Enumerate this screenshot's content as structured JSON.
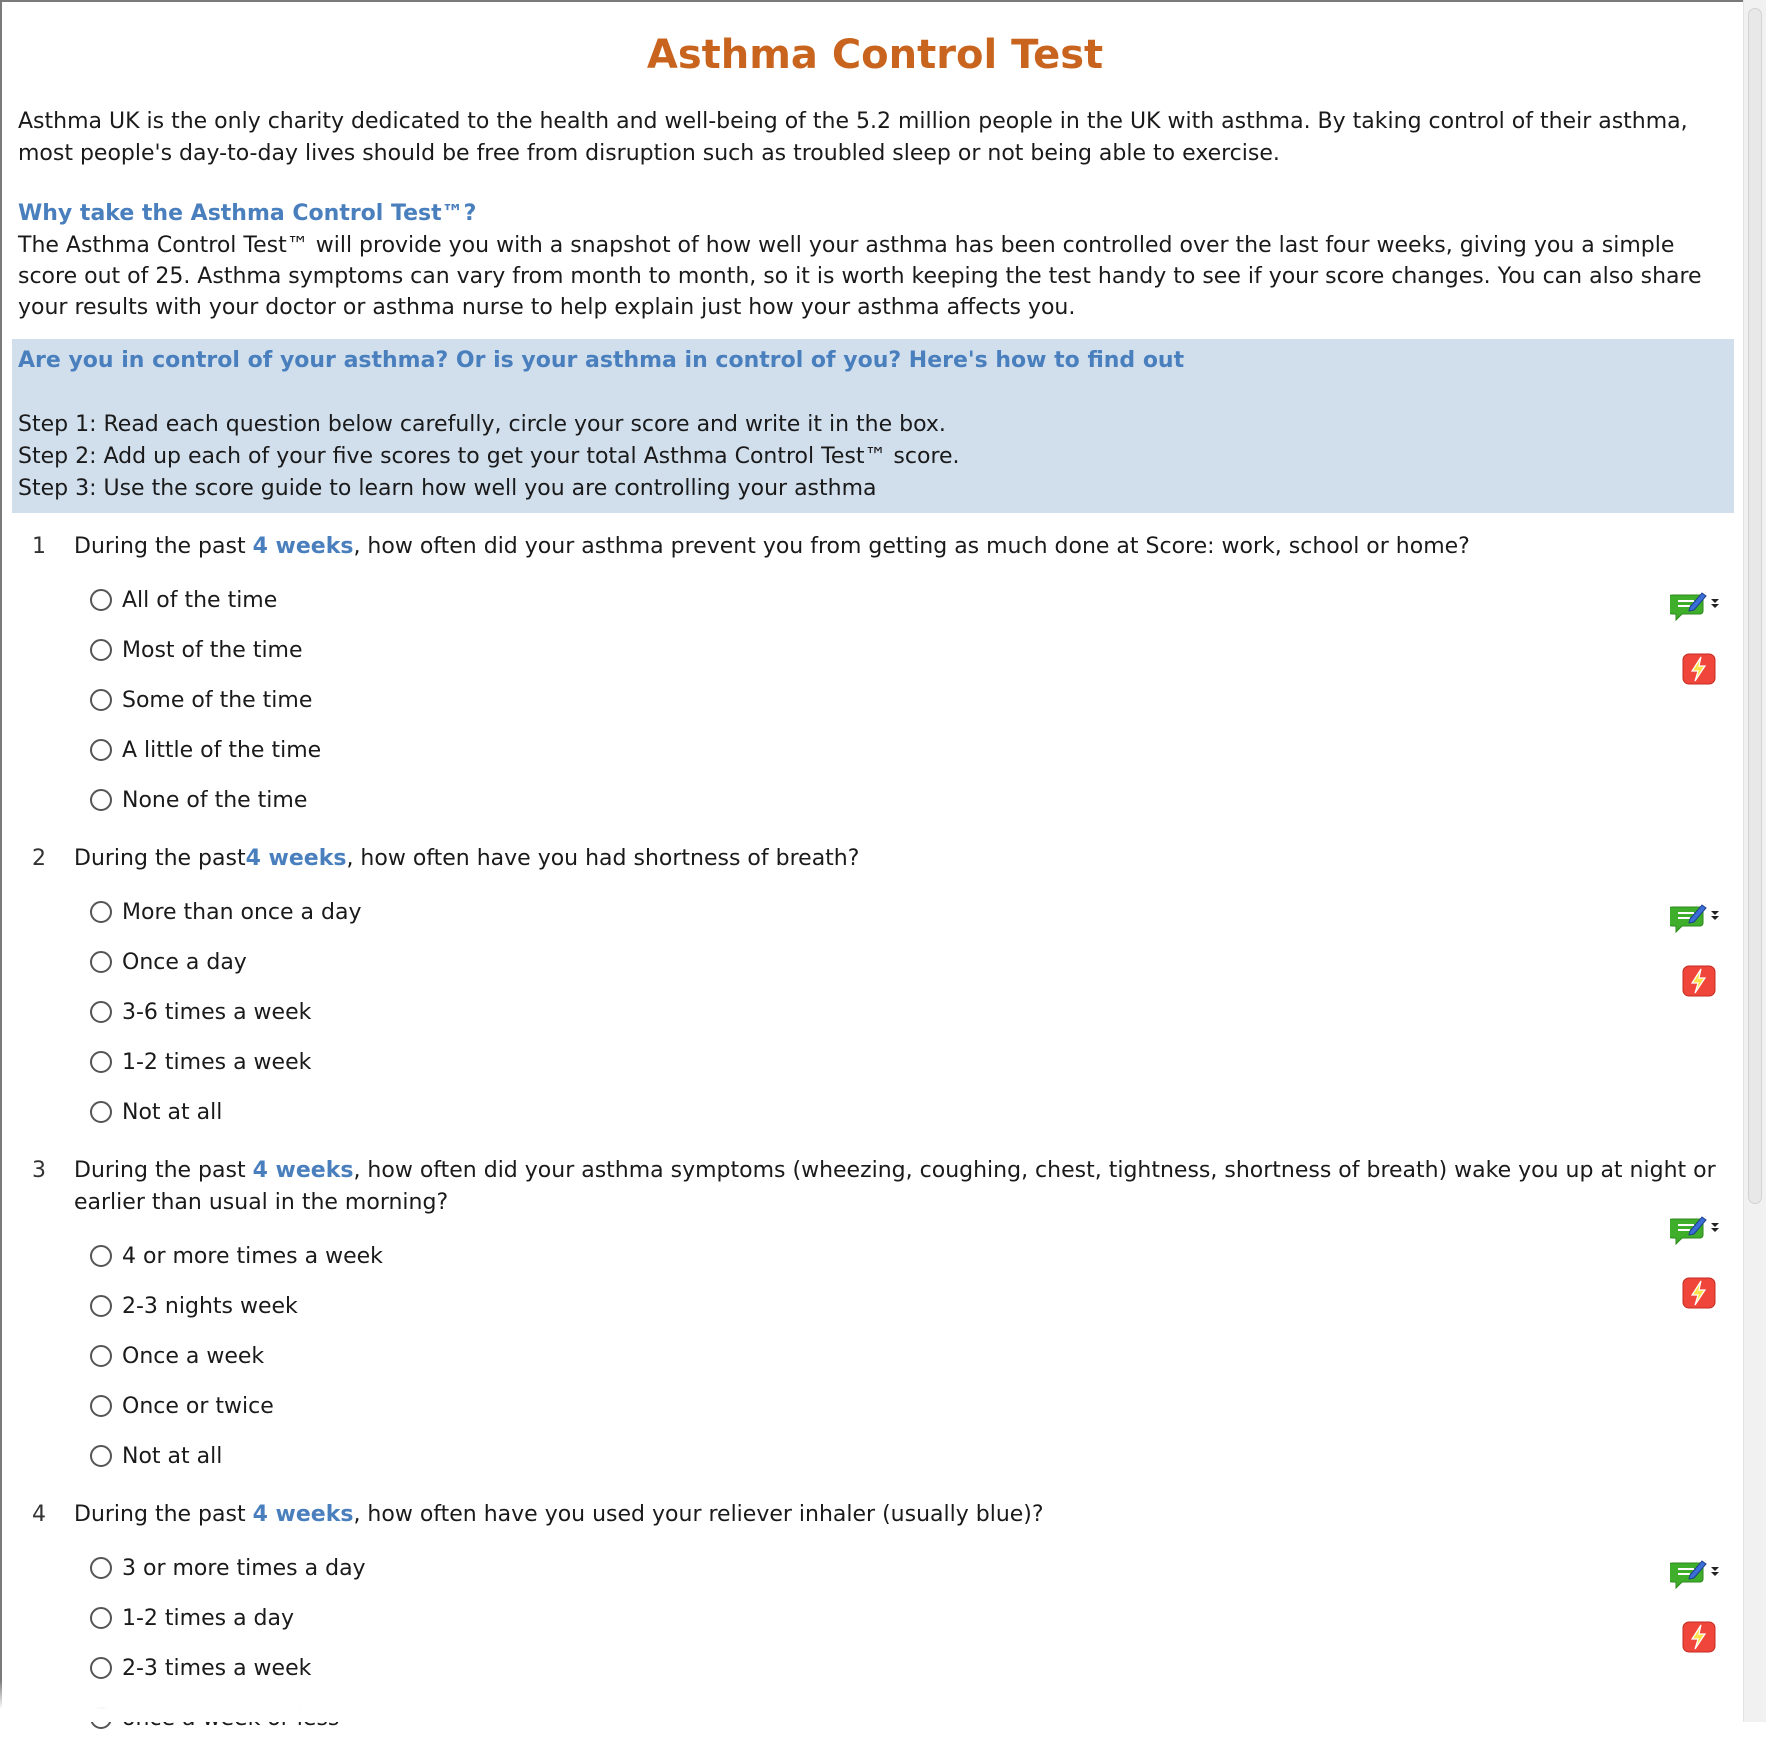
{
  "title": "Asthma Control Test",
  "intro": "Asthma UK is the only charity dedicated to the health and well-being of the 5.2 million people in the UK with asthma. By taking control of their asthma, most people's day-to-day lives should be free from disruption such as troubled sleep or not being able to exercise.",
  "why_heading": "Why take the Asthma Control Test™?",
  "why_text": "The Asthma Control Test™ will provide you with a snapshot of how well your asthma has been controlled over the last four weeks, giving you a simple score out of 25. Asthma symptoms can vary from month to month, so it is worth keeping the test handy to see if your score changes. You can also share your results with your doctor or asthma nurse to help explain just how your asthma affects you.",
  "how": {
    "heading": "Are you in control of your asthma? Or is your asthma in control of you? Here's how to find out",
    "steps": [
      "Step 1: Read each question below carefully, circle your score and write it in the box.",
      "Step 2: Add up each of your five scores to get your total Asthma Control Test™ score.",
      "Step 3: Use the score guide to learn how well you are controlling your asthma"
    ]
  },
  "icons": {
    "comment": "comment-edit-icon",
    "flash": "flash-icon"
  },
  "colors": {
    "title": "#c8641e",
    "accent": "#4a7fbe",
    "instructions_bg": "#d1dfed"
  },
  "questions": [
    {
      "number": "1",
      "before": "During the past ",
      "highlight": "4 weeks",
      "after": ", how often did your asthma prevent you from getting as much done at Score: work, school or home?",
      "options": [
        "All of the time",
        "Most of the time",
        "Some of the time",
        "A little of the time",
        "None of the time"
      ]
    },
    {
      "number": "2",
      "before": "During the past",
      "highlight": "4 weeks",
      "after": ", how often have you had shortness of breath?",
      "options": [
        "More than once a day",
        "Once a day",
        "3-6 times a week",
        "1-2 times a week",
        "Not at all"
      ]
    },
    {
      "number": "3",
      "before": "During the past ",
      "highlight": "4 weeks",
      "after": ", how often did your asthma symptoms (wheezing, coughing, chest, tightness, shortness of breath) wake you up at night or earlier than usual in the morning?",
      "options": [
        "4 or more times a week",
        "2-3 nights week",
        "Once a week",
        "Once or twice",
        "Not at all"
      ]
    },
    {
      "number": "4",
      "before": "During the past ",
      "highlight": "4 weeks",
      "after": ", how often have you used your reliever inhaler (usually blue)?",
      "options": [
        "3 or more times a day",
        "1-2 times a day",
        "2-3 times a week",
        "once a week or less"
      ]
    }
  ]
}
